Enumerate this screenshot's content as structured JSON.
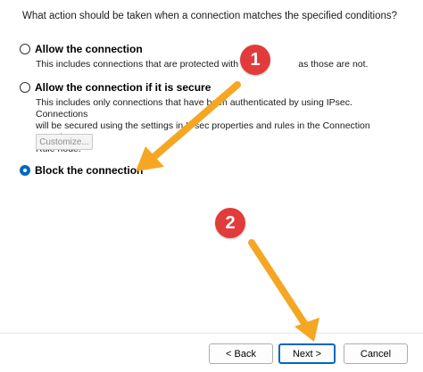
{
  "question": "What action should be taken when a connection matches the specified conditions?",
  "options": [
    {
      "label": "Allow the connection",
      "desc_before": "This includes connections that are protected with IPsec",
      "desc_after": "as those are not.",
      "selected": false
    },
    {
      "label": "Allow the connection if it is secure",
      "desc_l1": "This includes only connections that have been authenticated by using IPsec.  Connections",
      "desc_l2": "will be secured using the settings in IPsec properties and rules in the Connection Security",
      "desc_l3": "Rule node.",
      "selected": false
    },
    {
      "label": "Block the connection",
      "selected": true
    }
  ],
  "customize_label": "Customize...",
  "buttons": {
    "back": "< Back",
    "next": "Next >",
    "cancel": "Cancel"
  },
  "annotations": [
    {
      "number": "1"
    },
    {
      "number": "2"
    }
  ],
  "colors": {
    "arrow": "#f5a623",
    "badge": "#e23b3b",
    "accent": "#0067c0"
  }
}
